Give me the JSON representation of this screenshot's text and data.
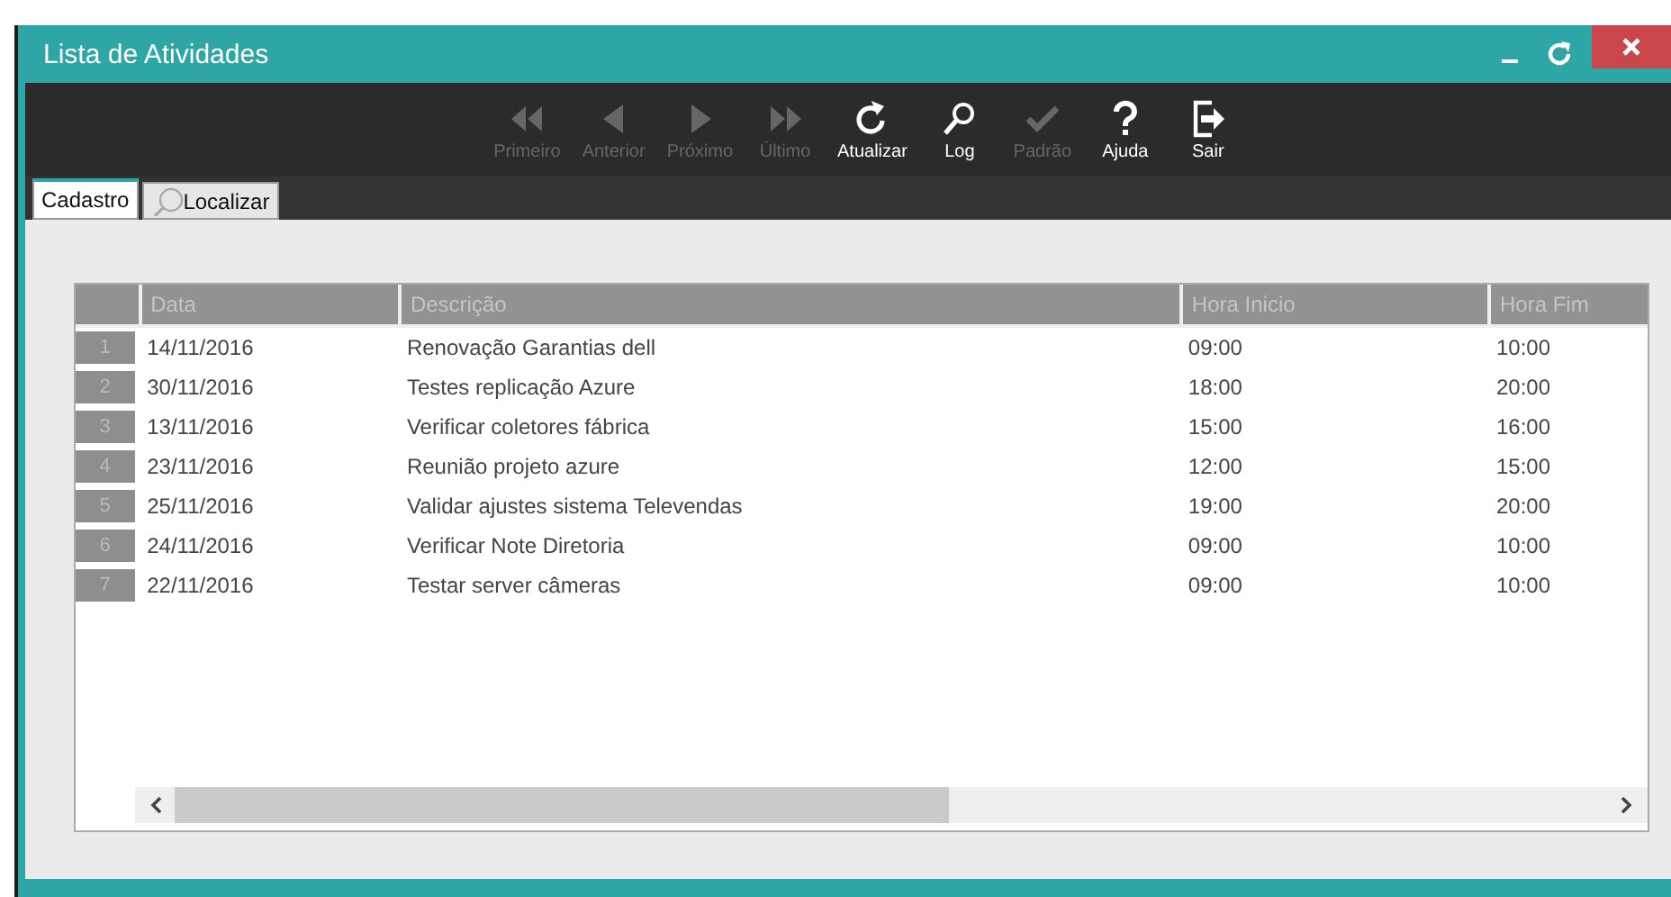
{
  "window": {
    "title": "Lista de Atividades",
    "controls": [
      {
        "kind": "minimize"
      },
      {
        "kind": "refresh"
      },
      {
        "kind": "close"
      }
    ]
  },
  "toolbar": [
    {
      "kind": "first",
      "label": "Primeiro",
      "disabled": true
    },
    {
      "kind": "prev",
      "label": "Anterior",
      "disabled": true
    },
    {
      "kind": "next",
      "label": "Próximo",
      "disabled": true
    },
    {
      "kind": "last",
      "label": "Último",
      "disabled": true
    },
    {
      "kind": "refresh",
      "label": "Atualizar",
      "disabled": false
    },
    {
      "kind": "search",
      "label": "Log",
      "disabled": false
    },
    {
      "kind": "check",
      "label": "Padrão",
      "disabled": true
    },
    {
      "kind": "help",
      "label": "Ajuda",
      "disabled": false
    },
    {
      "kind": "exit",
      "label": "Sair",
      "disabled": false
    }
  ],
  "tabs": [
    {
      "label": "Cadastro",
      "selected": true,
      "icon": false
    },
    {
      "label": "Localizar",
      "selected": false,
      "icon": true
    }
  ],
  "table": {
    "columns": [
      "Data",
      "Descrição",
      "Hora Inicio",
      "Hora Fim"
    ],
    "rows": [
      {
        "number": "1",
        "cells": [
          "14/11/2016",
          "Renovação Garantias dell",
          "09:00",
          "10:00"
        ]
      },
      {
        "number": "2",
        "cells": [
          "30/11/2016",
          "Testes replicação Azure",
          "18:00",
          "20:00"
        ]
      },
      {
        "number": "3",
        "cells": [
          "13/11/2016",
          "Verificar coletores fábrica",
          "15:00",
          "16:00"
        ]
      },
      {
        "number": "4",
        "cells": [
          "23/11/2016",
          "Reunião projeto azure",
          "12:00",
          "15:00"
        ]
      },
      {
        "number": "5",
        "cells": [
          "25/11/2016",
          "Validar ajustes sistema Televendas",
          "19:00",
          "20:00"
        ]
      },
      {
        "number": "6",
        "cells": [
          "24/11/2016",
          "Verificar Note Diretoria",
          "09:00",
          "10:00"
        ]
      },
      {
        "number": "7",
        "cells": [
          "22/11/2016",
          "Testar server câmeras",
          "09:00",
          "10:00"
        ]
      }
    ]
  }
}
